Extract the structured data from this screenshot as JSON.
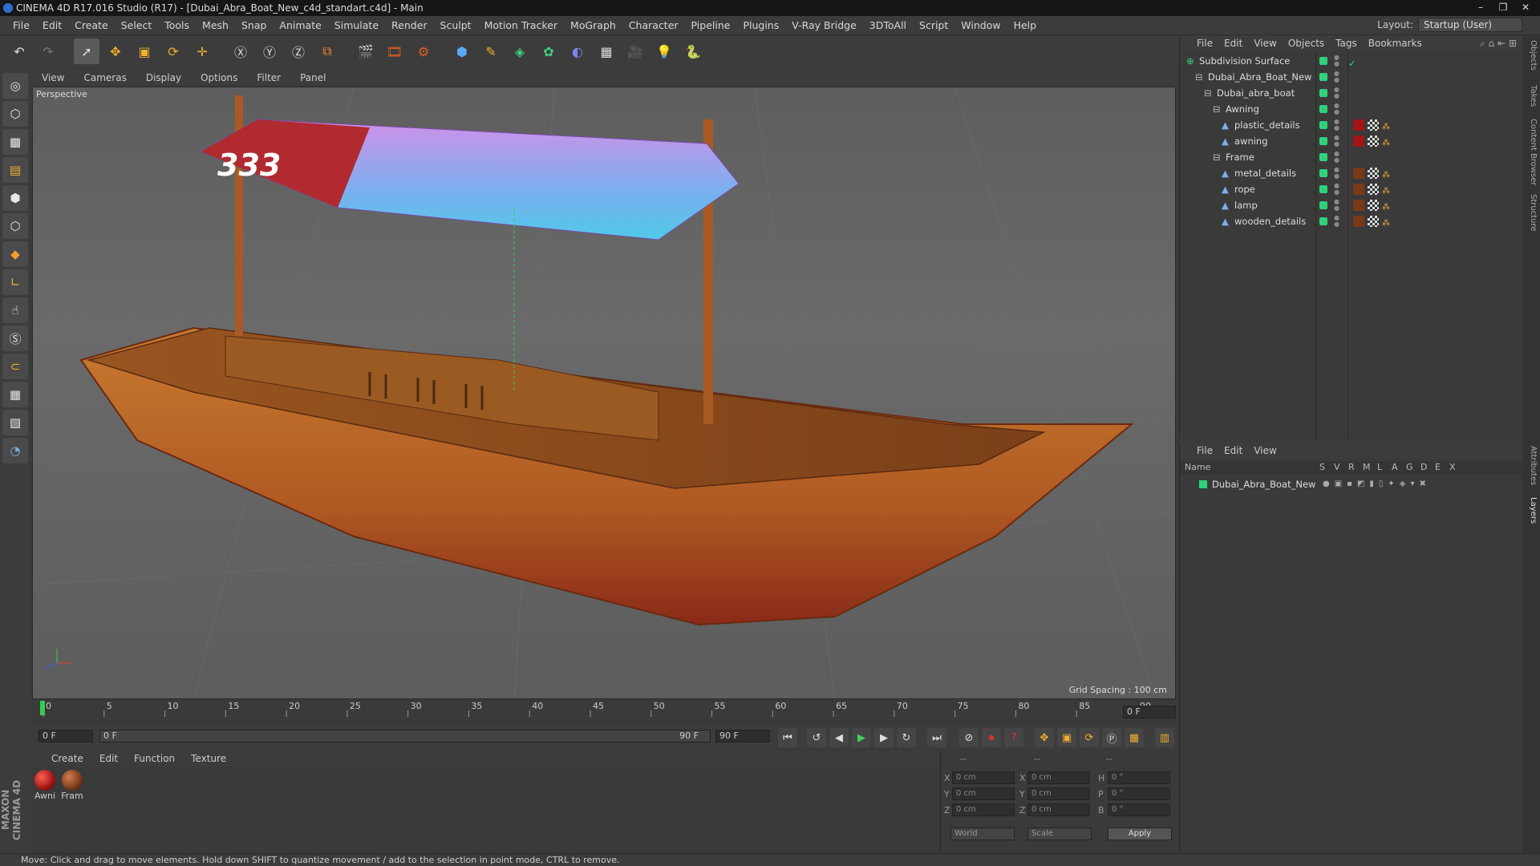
{
  "window": {
    "title": "CINEMA 4D R17.016 Studio (R17) - [Dubai_Abra_Boat_New_c4d_standart.c4d] - Main"
  },
  "menu": [
    "File",
    "Edit",
    "Create",
    "Select",
    "Tools",
    "Mesh",
    "Snap",
    "Animate",
    "Simulate",
    "Render",
    "Sculpt",
    "Motion Tracker",
    "MoGraph",
    "Character",
    "Pipeline",
    "Plugins",
    "V-Ray Bridge",
    "3DToAll",
    "Script",
    "Window",
    "Help"
  ],
  "layout": {
    "label": "Layout:",
    "value": "Startup (User)"
  },
  "viewport": {
    "menu": [
      "View",
      "Cameras",
      "Display",
      "Options",
      "Filter",
      "Panel"
    ],
    "camera_label": "Perspective",
    "grid_spacing": "Grid Spacing : 100 cm",
    "banner_text": "333"
  },
  "timeline": {
    "ticks": [
      "0",
      "5",
      "10",
      "15",
      "20",
      "25",
      "30",
      "35",
      "40",
      "45",
      "50",
      "55",
      "60",
      "65",
      "70",
      "75",
      "80",
      "85",
      "90"
    ],
    "end_field": "0 F",
    "start_field": "0 F",
    "range_start": "0 F",
    "range_end": "90 F",
    "max_field": "90 F"
  },
  "materials": {
    "menu": [
      "Create",
      "Edit",
      "Function",
      "Texture"
    ],
    "items": [
      {
        "label": "Awni",
        "color": "#a01515"
      },
      {
        "label": "Fram",
        "color": "#7a3a18"
      }
    ]
  },
  "coords": {
    "header": [
      "--",
      "--",
      "--"
    ],
    "rows": [
      {
        "a": "X",
        "av": "0 cm",
        "b": "X",
        "bv": "0 cm",
        "c": "H",
        "cv": "0 °"
      },
      {
        "a": "Y",
        "av": "0 cm",
        "b": "Y",
        "bv": "0 cm",
        "c": "P",
        "cv": "0 °"
      },
      {
        "a": "Z",
        "av": "0 cm",
        "b": "Z",
        "bv": "0 cm",
        "c": "B",
        "cv": "0 °"
      }
    ],
    "world": "World",
    "scale": "Scale",
    "apply": "Apply"
  },
  "objects": {
    "menu": [
      "File",
      "Edit",
      "View",
      "Objects",
      "Tags",
      "Bookmarks"
    ],
    "tree": [
      {
        "name": "Subdivision Surface",
        "depth": 0
      },
      {
        "name": "Dubai_Abra_Boat_New",
        "depth": 1
      },
      {
        "name": "Dubai_abra_boat",
        "depth": 2
      },
      {
        "name": "Awning",
        "depth": 3
      },
      {
        "name": "plastic_details",
        "depth": 4
      },
      {
        "name": "awning",
        "depth": 4
      },
      {
        "name": "Frame",
        "depth": 3
      },
      {
        "name": "metal_details",
        "depth": 4
      },
      {
        "name": "rope",
        "depth": 4
      },
      {
        "name": "lamp",
        "depth": 4
      },
      {
        "name": "wooden_details",
        "depth": 4
      }
    ]
  },
  "layers": {
    "menu": [
      "File",
      "Edit",
      "View"
    ],
    "header": {
      "name": "Name",
      "cols": [
        "S",
        "V",
        "R",
        "M",
        "L",
        "A",
        "G",
        "D",
        "E",
        "X"
      ]
    },
    "items": [
      {
        "name": "Dubai_Abra_Boat_New"
      }
    ]
  },
  "right_tabs": [
    "Objects",
    "Takes",
    "Content Browser",
    "Structure",
    "Attributes",
    "Layers"
  ],
  "status": "Move: Click and drag to move elements. Hold down SHIFT to quantize movement / add to the selection in point mode, CTRL to remove.",
  "logo": "MAXON CINEMA 4D"
}
